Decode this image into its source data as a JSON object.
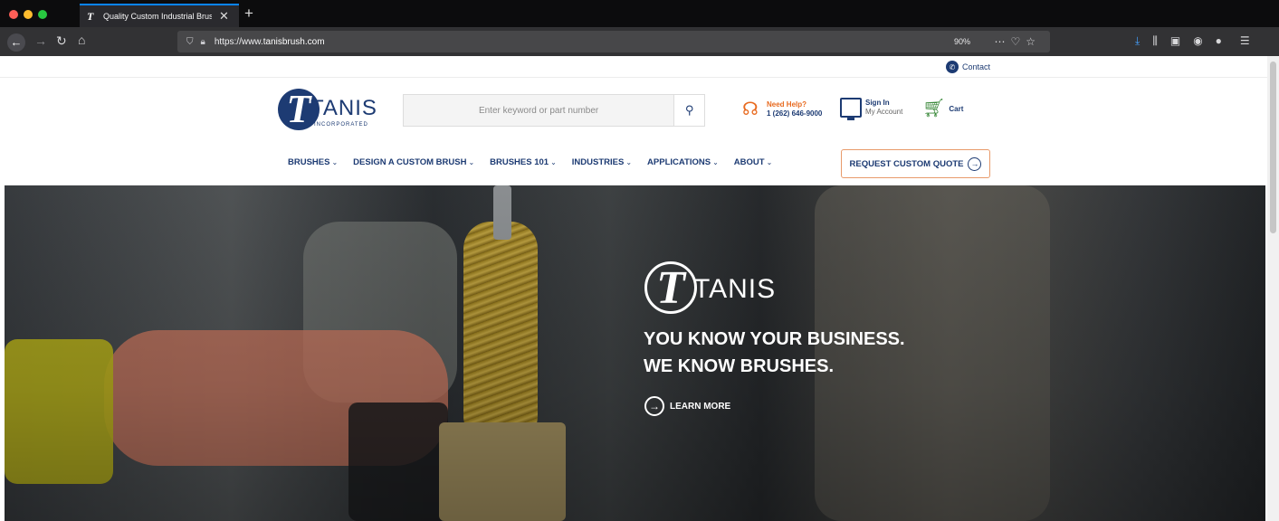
{
  "browser": {
    "tab_title": "Quality Custom Industrial Brush",
    "tab_favicon": "T",
    "new_tab": "+",
    "url_prefix": "https://www.",
    "url_host": "tanisbrush.com",
    "zoom": "90%",
    "icons": {
      "back": "arrow-left-icon",
      "forward": "arrow-right-icon",
      "reload": "reload-icon",
      "home": "home-icon",
      "shield": "shield-icon",
      "lock": "lock-icon",
      "more": "more-icon",
      "pocket": "pocket-icon",
      "bookmark": "star-icon",
      "downloads": "download-icon",
      "library": "library-icon",
      "sidebar": "sidebar-icon",
      "account": "account-icon",
      "extension": "extension-icon",
      "menu": "hamburger-icon"
    },
    "colors": {
      "tab_accent": "#0a84ff",
      "downloads": "#45a1ff"
    }
  },
  "site": {
    "contact_label": "Contact",
    "logo": {
      "letter": "T",
      "word": "TANIS",
      "sub": "INCORPORATED"
    },
    "search": {
      "placeholder": "Enter keyword or part number"
    },
    "help": {
      "title": "Need Help?",
      "phone": "1 (262) 646-9000"
    },
    "account": {
      "title": "Sign In",
      "sub": "My Account"
    },
    "cart_label": "Cart",
    "nav": [
      {
        "label": "BRUSHES"
      },
      {
        "label": "DESIGN A CUSTOM BRUSH"
      },
      {
        "label": "BRUSHES 101"
      },
      {
        "label": "INDUSTRIES"
      },
      {
        "label": "APPLICATIONS"
      },
      {
        "label": "ABOUT"
      }
    ],
    "quote_label": "REQUEST CUSTOM QUOTE",
    "colors": {
      "brand": "#1d3b73",
      "help": "#e86a1f",
      "cart": "#3c8a3c",
      "quote_border": "#e89a6a"
    }
  },
  "hero": {
    "logo_letter": "T",
    "logo_word": "TANIS",
    "line1": "YOU KNOW YOUR BUSINESS.",
    "line2": "WE KNOW BRUSHES.",
    "cta": "LEARN MORE"
  }
}
